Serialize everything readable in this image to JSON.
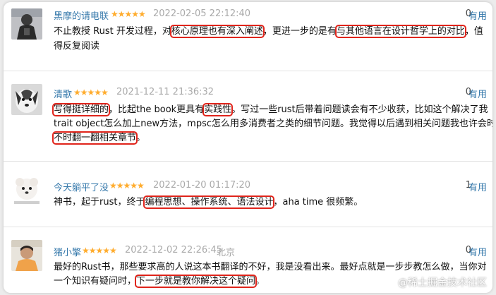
{
  "reviews": [
    {
      "user": "黑摩的请电联",
      "stars": "★★★★★",
      "time": "2022-02-05 22:12:40",
      "location": "",
      "votes": "0",
      "useful_label": "有用",
      "lines": [
        [
          "不止教授 Rust 开发过程，对",
          {
            "hl": "核心原理也有深入阐述"
          },
          "，更进一步的是有",
          {
            "hl": "与其他语言在设计哲学上的对比"
          },
          "，值"
        ],
        [
          "得反复阅读"
        ]
      ]
    },
    {
      "user": "清歌",
      "stars": "★★★★★",
      "time": "2021-12-11 21:36:32",
      "location": "",
      "votes": "0",
      "useful_label": "有用",
      "lines": [
        [
          {
            "hl": "写得挺详细的"
          },
          "，比起the book更具有",
          {
            "hl": "实践性"
          },
          "。写过一些rust后带着问题读会有不少收获，比如这个解决了我"
        ],
        [
          "trait object怎么加上new方法，mpsc怎么用多消费者之类的细节问题。我觉得以后遇到相关问题我也许会时"
        ],
        [
          {
            "hl": "不时翻一翻相关章节"
          },
          "。"
        ]
      ]
    },
    {
      "user": "今天躺平了没",
      "stars": "★★★★★",
      "time": "2022-01-20 01:17:20",
      "location": "",
      "votes": "1",
      "useful_label": "有用",
      "lines": [
        [
          "神书，起于rust，终于",
          {
            "hl": "编程思想、操作系统、语法设计"
          },
          "，aha time 很频繁。"
        ]
      ]
    },
    {
      "user": "猪小擎",
      "stars": "★★★★★",
      "time": "2022-12-02 22:26:45",
      "location": "北京",
      "votes": "0",
      "useful_label": "有用",
      "lines": [
        [
          "最好的Rust书，那些要求高的人说这本书翻译的不好，我是没看出来。最好点就是一步步教怎么做，当你对"
        ],
        [
          "一个知识有疑问时，",
          {
            "hl": "下一步就是教你解决这个疑问"
          },
          "。"
        ]
      ]
    }
  ],
  "watermark": "@稀土掘金技术社区",
  "colors": {
    "link": "#3377aa",
    "star": "#ffac2d",
    "highlight": "#e0241b",
    "meta": "#aaaaaa"
  }
}
